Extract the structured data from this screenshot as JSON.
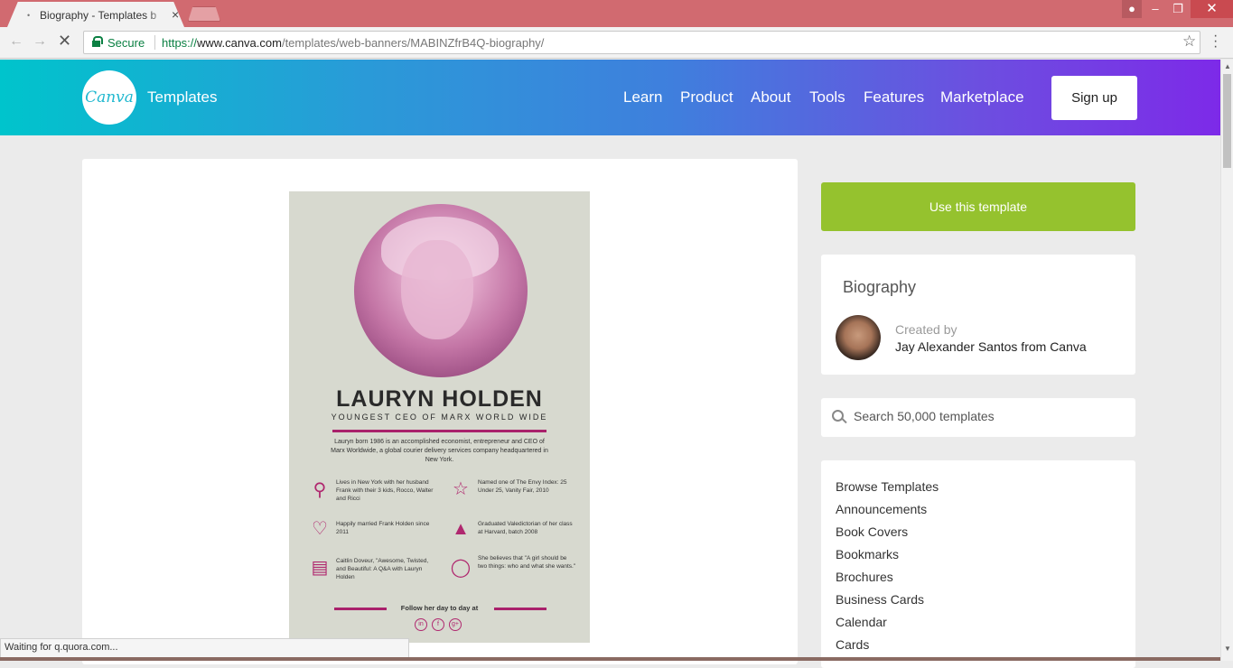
{
  "browser": {
    "tab_title": "Biography - Templates b",
    "tab_close": "×",
    "win_min": "–",
    "win_max": "❐",
    "win_close": "✕",
    "secure_label": "Secure",
    "url_scheme": "https://",
    "url_host": "www.canva.com",
    "url_path": "/templates/web-banners/MABINZfrB4Q-biography/",
    "status_text": "Waiting for q.quora.com..."
  },
  "header": {
    "logo_text": "Canva",
    "brand": "Templates",
    "nav": [
      "Learn",
      "Product",
      "About",
      "Tools",
      "Features",
      "Marketplace"
    ],
    "signup_label": "Sign up",
    "gradient_start": "#00c4cc",
    "gradient_end": "#7d2ae8"
  },
  "poster": {
    "name": "LAURYN HOLDEN",
    "subtitle": "YOUNGEST CEO OF MARX WORLD WIDE",
    "bio": "Lauryn born 1986 is an accomplished economist, entrepreneur and CEO of Marx Worldwide, a global courier delivery services company headquartered in New York.",
    "facts": [
      {
        "icon": "location-pin-icon",
        "text": "Lives in New York with her husband Frank with their 3 kids, Rocco, Walter and Ricci"
      },
      {
        "icon": "star-icon",
        "text": "Named one of The Envy Index: 25 Under 25, Vanity Fair, 2010"
      },
      {
        "icon": "heart-icon",
        "text": "Happily married Frank Holden since 2011"
      },
      {
        "icon": "graduation-cap-icon",
        "text": "Graduated Valedictorian of her class at Harvard, batch 2008"
      },
      {
        "icon": "newspaper-icon",
        "text": "Caitlin Doveur, \"Awesome, Twisted, and Beautiful: A Q&A with Lauryn Holden"
      },
      {
        "icon": "speech-bubble-icon",
        "text": "She believes that \"A girl should be two things: who and what she wants.\""
      }
    ],
    "follow": "Follow her day to day at",
    "social": [
      "in",
      "f",
      "g+"
    ],
    "accent_color": "#a9216b"
  },
  "sidebar": {
    "use_template_label": "Use this template",
    "use_template_color": "#95c22e",
    "template_name": "Biography",
    "created_by_label": "Created by",
    "author": "Jay Alexander Santos from Canva",
    "search_placeholder": "Search 50,000 templates",
    "browse": [
      "Browse Templates",
      "Announcements",
      "Book Covers",
      "Bookmarks",
      "Brochures",
      "Business Cards",
      "Calendar",
      "Cards"
    ]
  }
}
